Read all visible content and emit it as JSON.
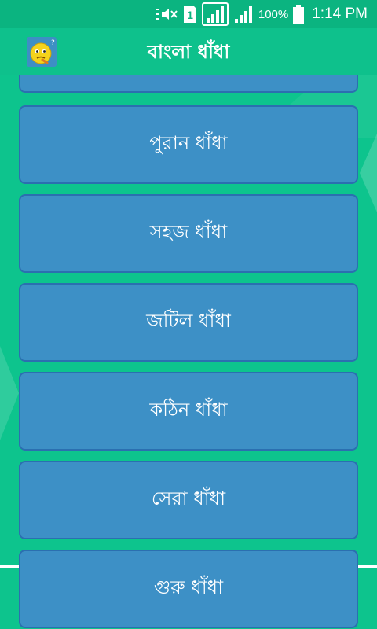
{
  "status_bar": {
    "battery": "100%",
    "time": "1:14 PM",
    "sim_slot": "1"
  },
  "app_bar": {
    "title": "বাংলা ধাঁধা",
    "logo_icon": "thinking-face-icon"
  },
  "menu": {
    "items": [
      {
        "label": ""
      },
      {
        "label": "পুরান ধাঁধা"
      },
      {
        "label": "সহজ ধাঁধা"
      },
      {
        "label": "জটিল ধাঁধা"
      },
      {
        "label": "কঠিন ধাঁধা"
      },
      {
        "label": "সেরা ধাঁধা"
      },
      {
        "label": "গুরু ধাঁধা"
      }
    ]
  },
  "colors": {
    "background": "#0dc48d",
    "status_bar": "#0bb480",
    "button_fill": "#3d90c6",
    "button_border": "#2b6fb0",
    "text": "#ffffff"
  }
}
